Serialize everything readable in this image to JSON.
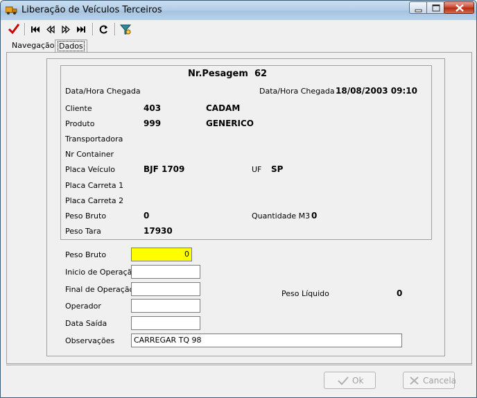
{
  "window": {
    "title": "Liberação de Veículos Terceiros",
    "app_icon": "truck-icon",
    "controls": [
      "minimize-icon",
      "maximize-icon",
      "close-icon"
    ]
  },
  "toolbar": {
    "buttons": [
      "checkmark-icon",
      "first-record-icon",
      "previous-record-icon",
      "next-record-icon",
      "last-record-icon",
      "refresh-icon",
      "filter-icon"
    ]
  },
  "tabs": {
    "nav": "Navegação",
    "dados": "Dados",
    "active": "Dados"
  },
  "info": {
    "nr_pesagem_label": "Nr.Pesagem",
    "nr_pesagem_value": "62",
    "data_hora_chegada_label_left": "Data/Hora Chegada",
    "data_hora_chegada_label_right": "Data/Hora Chegada",
    "data_hora_chegada_value": "18/08/2003 09:10",
    "cliente_label": "Cliente",
    "cliente_code": "403",
    "cliente_name": "CADAM",
    "produto_label": "Produto",
    "produto_code": "999",
    "produto_name": "GENERICO",
    "transportadora_label": "Transportadora",
    "nr_container_label": "Nr Container",
    "placa_veiculo_label": "Placa Veículo",
    "placa_veiculo_value": "BJF 1709",
    "uf_label": "UF",
    "uf_value": "SP",
    "placa_carreta1_label": "Placa Carreta 1",
    "placa_carreta2_label": "Placa Carreta 2",
    "peso_bruto_label": "Peso Bruto",
    "peso_bruto_value": "0",
    "quantidade_m3_label": "Quantidade M3",
    "quantidade_m3_value": "0",
    "peso_tara_label": "Peso Tara",
    "peso_tara_value": "17930"
  },
  "form": {
    "peso_bruto_label": "Peso Bruto",
    "peso_bruto_value": "0",
    "inicio_operacao_label": "Inicio de Operação",
    "inicio_operacao_value": "",
    "final_operacao_label": "Final de Operação",
    "final_operacao_value": "",
    "operador_label": "Operador",
    "operador_value": "",
    "data_saida_label": "Data Saída",
    "data_saida_value": "",
    "observacoes_label": "Observações",
    "observacoes_value": "CARREGAR TQ 98",
    "peso_liquido_label": "Peso Líquido",
    "peso_liquido_value": "0"
  },
  "buttons": {
    "ok": "Ok",
    "cancel": "Cancela"
  },
  "colors": {
    "highlight_field": "#ffff00",
    "accent_check": "#cc0000"
  }
}
